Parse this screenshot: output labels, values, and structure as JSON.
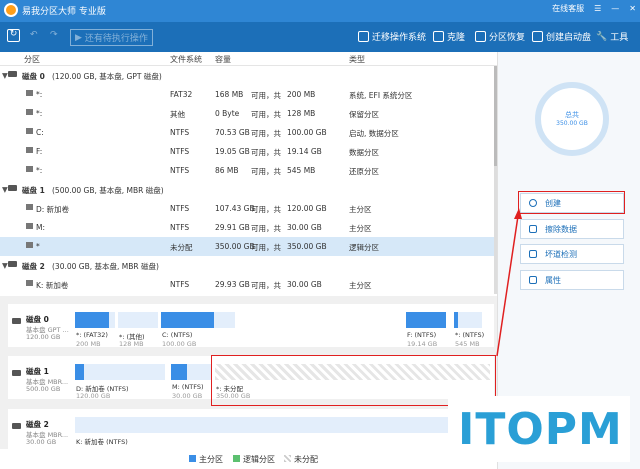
{
  "app": {
    "title": "易我分区大师 专业版",
    "online_help": "在线客服"
  },
  "toolbar": {
    "pending": "还有待执行操作",
    "items": [
      {
        "label": "迁移操作系统",
        "icon": "migrate-os-icon"
      },
      {
        "label": "克隆",
        "icon": "clone-icon"
      },
      {
        "label": "分区恢复",
        "icon": "partition-recovery-icon"
      },
      {
        "label": "创建启动盘",
        "icon": "boot-disk-icon"
      },
      {
        "label": "工具",
        "icon": "tools-icon"
      }
    ]
  },
  "columns": [
    "分区",
    "文件系统",
    "容量",
    "类型"
  ],
  "disks": [
    {
      "title": "磁盘 0",
      "info": "(120.00 GB, 基本盘, GPT 磁盘)",
      "partitions": [
        {
          "name": "*:",
          "fs": "FAT32",
          "used": "168 MB",
          "total": "200 MB",
          "type": "系统, EFI 系统分区"
        },
        {
          "name": "*:",
          "fs": "其他",
          "used": "0 Byte",
          "total": "128 MB",
          "type": "保留分区"
        },
        {
          "name": "C:",
          "fs": "NTFS",
          "used": "70.53 GB",
          "total": "100.00 GB",
          "type": "启动, 数据分区"
        },
        {
          "name": "F:",
          "fs": "NTFS",
          "used": "19.05 GB",
          "total": "19.14 GB",
          "type": "数据分区"
        },
        {
          "name": "*:",
          "fs": "NTFS",
          "used": "86 MB",
          "total": "545 MB",
          "type": "还原分区"
        }
      ]
    },
    {
      "title": "磁盘 1",
      "info": "(500.00 GB, 基本盘, MBR 磁盘)",
      "partitions": [
        {
          "name": "D: 新加卷",
          "fs": "NTFS",
          "used": "107.43 GB",
          "total": "120.00 GB",
          "type": "主分区"
        },
        {
          "name": "M:",
          "fs": "NTFS",
          "used": "29.91 GB",
          "total": "30.00 GB",
          "type": "主分区"
        },
        {
          "name": "*",
          "fs": "未分配",
          "used": "350.00 GB",
          "total": "350.00 GB",
          "type": "逻辑分区"
        }
      ]
    },
    {
      "title": "磁盘 2",
      "info": "(30.00 GB, 基本盘, MBR 磁盘)",
      "partitions": [
        {
          "name": "K: 新加卷",
          "fs": "NTFS",
          "used": "29.93 GB",
          "total": "30.00 GB",
          "type": "主分区"
        }
      ]
    }
  ],
  "row_mid": "可用，共",
  "map": [
    {
      "name": "磁盘 0",
      "sub1": "基本盘 GPT ...",
      "sub2": "120.00 GB",
      "segs": [
        {
          "l1": "*: (FAT32)",
          "l2": "200 MB",
          "fill": 0.84
        },
        {
          "l1": "*: (其他)",
          "l2": "128 MB",
          "fill": 0.0
        },
        {
          "l1": "C: (NTFS)",
          "l2": "100.00 GB",
          "fill": 0.71
        },
        {
          "l1": "F: (NTFS)",
          "l2": "19.14 GB",
          "fill": 0.99
        },
        {
          "l1": "*: (NTFS)",
          "l2": "545 MB",
          "fill": 0.16
        }
      ]
    },
    {
      "name": "磁盘 1",
      "sub1": "基本盘 MBR...",
      "sub2": "500.00 GB",
      "segs": [
        {
          "l1": "D: 新加卷 (NTFS)",
          "l2": "120.00 GB",
          "fill": 0.1
        },
        {
          "l1": "M: (NTFS)",
          "l2": "30.00 GB",
          "fill": 0.4
        },
        {
          "l1": "*: 未分配",
          "l2": "350.00 GB",
          "fill": 0
        }
      ]
    },
    {
      "name": "磁盘 2",
      "sub1": "基本盘 MBR...",
      "sub2": "30.00 GB",
      "segs": [
        {
          "l1": "K: 新加卷 (NTFS)",
          "l2": "",
          "fill": 0
        }
      ]
    }
  ],
  "legend": [
    "主分区",
    "逻辑分区",
    "未分配"
  ],
  "summary": {
    "label": "总共",
    "size": "350.00 GB"
  },
  "actions": [
    {
      "label": "创建",
      "icon": "create-icon"
    },
    {
      "label": "擦除数据",
      "icon": "wipe-icon"
    },
    {
      "label": "坏道检测",
      "icon": "bad-sector-icon"
    },
    {
      "label": "属性",
      "icon": "properties-icon"
    }
  ],
  "watermark": "ITOPM",
  "colors": {
    "titlebar": "#2f86d4",
    "toolbar": "#1c6fb8",
    "primary": "#3a8ee6",
    "logical": "#5cc070",
    "highlight": "#e02020"
  }
}
